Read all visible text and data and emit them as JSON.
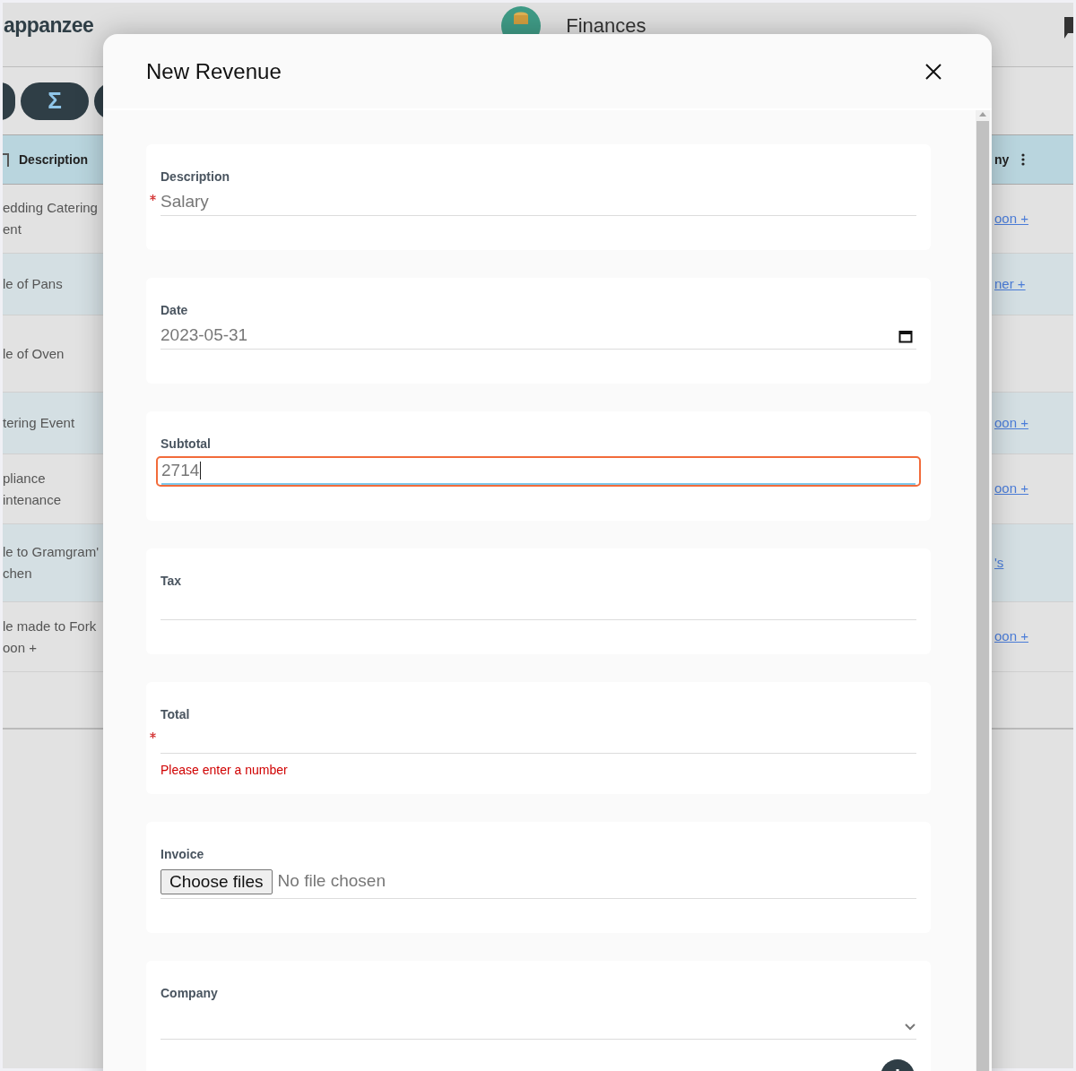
{
  "app": {
    "logo": "appanzee",
    "section": "Finances"
  },
  "toolbar": {
    "buttons": [
      {
        "label": "Σ"
      }
    ]
  },
  "table": {
    "columns": [
      "Description",
      "ny"
    ],
    "rows": [
      {
        "description": "edding Catering\nent",
        "column_2": "oon +"
      },
      {
        "description": "le of Pans",
        "column_2": "ner +"
      },
      {
        "description": "le of Oven",
        "column_2": null
      },
      {
        "description": "tering Event",
        "column_2": "oon +"
      },
      {
        "description": "pliance\nintenance",
        "column_2": "oon +"
      },
      {
        "description": "le to Gramgram'\nchen",
        "column_2": "'s"
      },
      {
        "description": "le made to Fork\noon +",
        "column_2": "oon +"
      }
    ]
  },
  "dialog": {
    "title": "New Revenue",
    "fields": [
      {
        "kind": "text",
        "label": "Description",
        "required": true,
        "value": "Salary",
        "focused": false
      },
      {
        "kind": "date",
        "label": "Date",
        "required": false,
        "value": "2023-05-31",
        "focused": false
      },
      {
        "kind": "text",
        "label": "Subtotal",
        "required": false,
        "value": "2714",
        "focused": true
      },
      {
        "kind": "text",
        "label": "Tax",
        "required": false,
        "focused": false
      },
      {
        "kind": "text",
        "label": "Total",
        "required": true,
        "focused": false,
        "error": "Please enter a number"
      },
      {
        "kind": "file",
        "label": "Invoice",
        "button": "Choose files",
        "status": "No file chosen"
      },
      {
        "kind": "select",
        "label": "Company",
        "add_button": true
      }
    ]
  }
}
